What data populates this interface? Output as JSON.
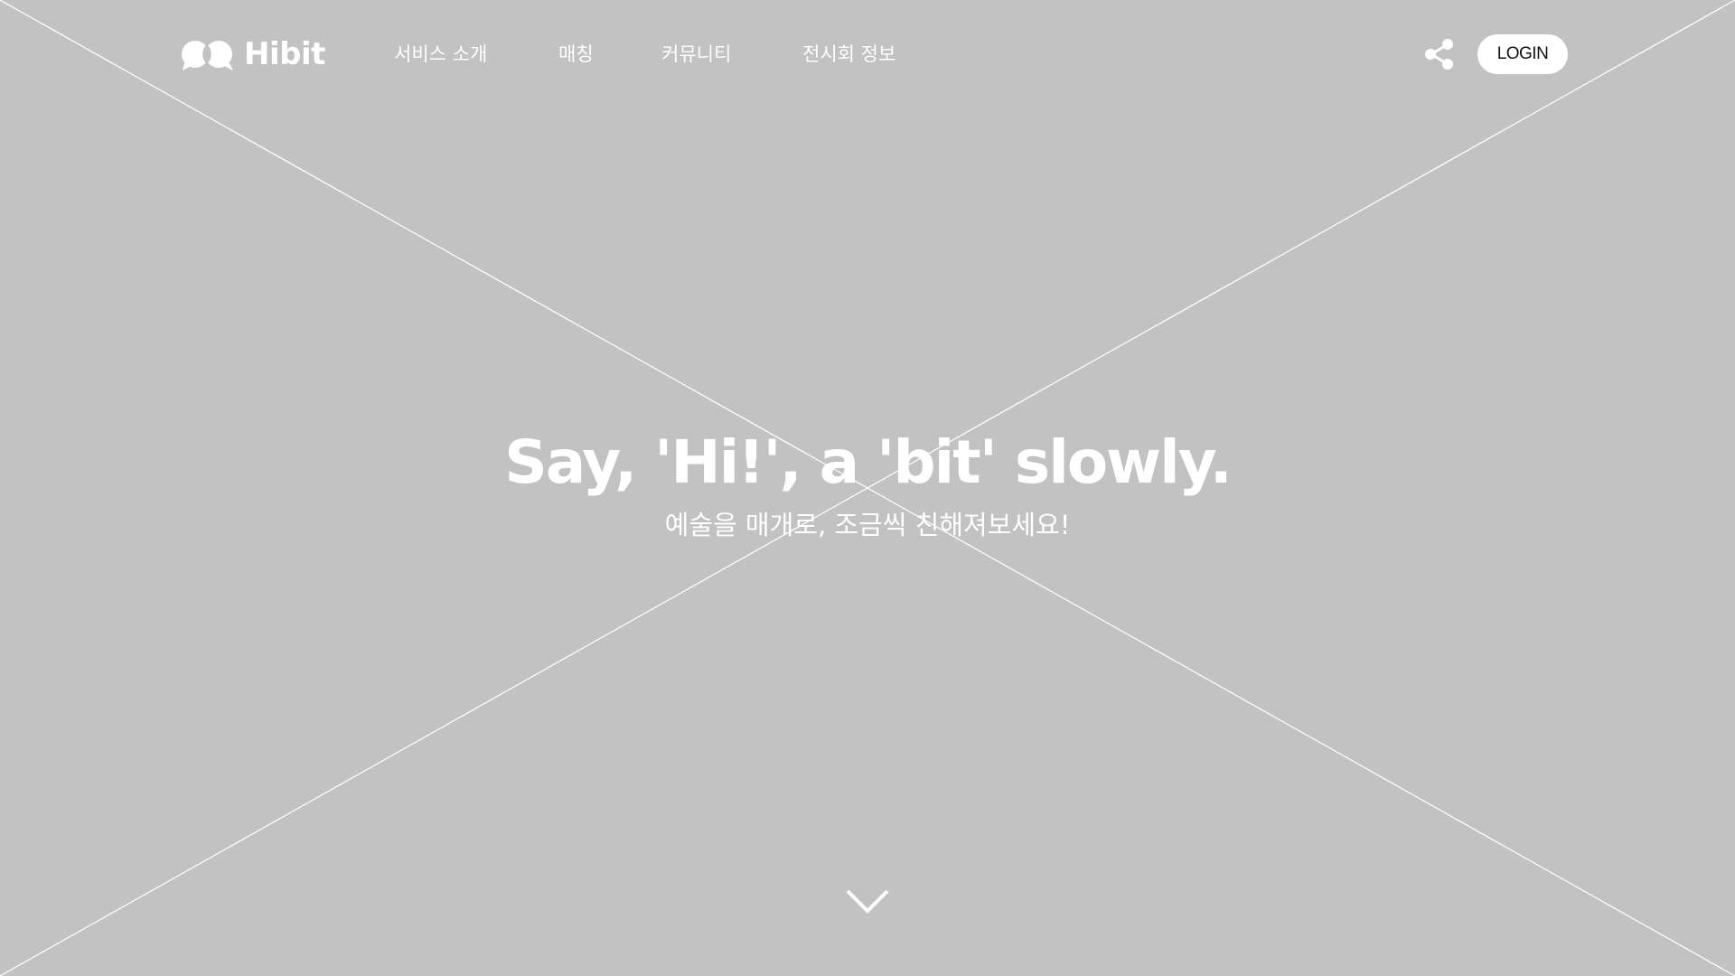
{
  "brand": {
    "name": "Hibit",
    "logo_icon": "speech-bubbles-logo-icon"
  },
  "nav": {
    "items": [
      {
        "label": "서비스 소개"
      },
      {
        "label": "매칭"
      },
      {
        "label": "커뮤니티"
      },
      {
        "label": "전시회 정보"
      }
    ]
  },
  "header": {
    "share_icon": "share-icon",
    "login_label": "LOGIN"
  },
  "hero": {
    "headline": "Say, 'Hi!', a 'bit' slowly.",
    "subline": "예술을 매개로, 조금씩 친해져보세요!",
    "scroll_icon": "chevron-down-icon"
  },
  "colors": {
    "background": "#c2c2c2",
    "text": "#ffffff",
    "button_bg": "#ffffff",
    "button_text": "#111111"
  }
}
